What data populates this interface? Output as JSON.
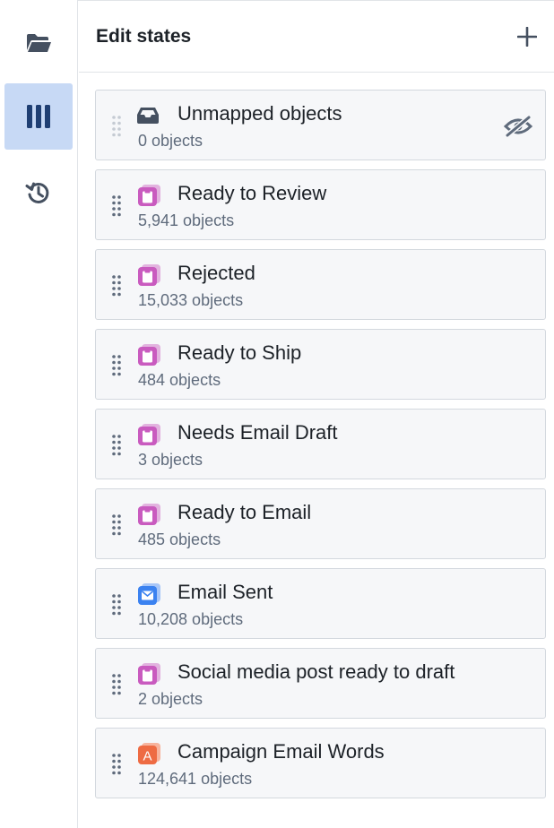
{
  "header": {
    "title": "Edit states"
  },
  "rail": {
    "items": [
      "folder-icon",
      "columns-icon",
      "history-icon"
    ],
    "active": "columns-icon"
  },
  "colors": {
    "accent_bg": "#c7d9f5",
    "accent": "#1f3f73",
    "state_purple": "#c95bbf",
    "state_blue": "#3b82f0",
    "state_orange": "#ee6b43"
  },
  "states": [
    {
      "name": "Unmapped objects",
      "count": "0 objects",
      "icon": "inbox-icon",
      "hidden": true
    },
    {
      "name": "Ready to Review",
      "count": "5,941 objects",
      "icon": "clipboard-icon"
    },
    {
      "name": "Rejected",
      "count": "15,033 objects",
      "icon": "clipboard-icon"
    },
    {
      "name": "Ready to Ship",
      "count": "484 objects",
      "icon": "clipboard-icon"
    },
    {
      "name": "Needs Email Draft",
      "count": "3 objects",
      "icon": "clipboard-icon"
    },
    {
      "name": "Ready to Email",
      "count": "485 objects",
      "icon": "clipboard-icon"
    },
    {
      "name": "Email Sent",
      "count": "10,208 objects",
      "icon": "envelope-icon"
    },
    {
      "name": "Social media post ready to draft",
      "count": "2 objects",
      "icon": "clipboard-icon"
    },
    {
      "name": "Campaign Email Words",
      "count": "124,641 objects",
      "icon": "letter-a-icon",
      "icon_text": "A"
    }
  ]
}
